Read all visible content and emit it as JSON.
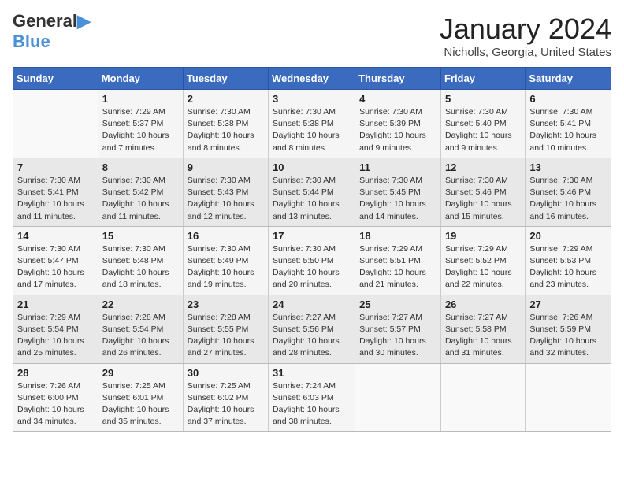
{
  "logo": {
    "text1": "General",
    "text2": "Blue"
  },
  "title": "January 2024",
  "location": "Nicholls, Georgia, United States",
  "headers": [
    "Sunday",
    "Monday",
    "Tuesday",
    "Wednesday",
    "Thursday",
    "Friday",
    "Saturday"
  ],
  "weeks": [
    [
      {
        "num": "",
        "info": ""
      },
      {
        "num": "1",
        "info": "Sunrise: 7:29 AM\nSunset: 5:37 PM\nDaylight: 10 hours\nand 7 minutes."
      },
      {
        "num": "2",
        "info": "Sunrise: 7:30 AM\nSunset: 5:38 PM\nDaylight: 10 hours\nand 8 minutes."
      },
      {
        "num": "3",
        "info": "Sunrise: 7:30 AM\nSunset: 5:38 PM\nDaylight: 10 hours\nand 8 minutes."
      },
      {
        "num": "4",
        "info": "Sunrise: 7:30 AM\nSunset: 5:39 PM\nDaylight: 10 hours\nand 9 minutes."
      },
      {
        "num": "5",
        "info": "Sunrise: 7:30 AM\nSunset: 5:40 PM\nDaylight: 10 hours\nand 9 minutes."
      },
      {
        "num": "6",
        "info": "Sunrise: 7:30 AM\nSunset: 5:41 PM\nDaylight: 10 hours\nand 10 minutes."
      }
    ],
    [
      {
        "num": "7",
        "info": "Sunrise: 7:30 AM\nSunset: 5:41 PM\nDaylight: 10 hours\nand 11 minutes."
      },
      {
        "num": "8",
        "info": "Sunrise: 7:30 AM\nSunset: 5:42 PM\nDaylight: 10 hours\nand 11 minutes."
      },
      {
        "num": "9",
        "info": "Sunrise: 7:30 AM\nSunset: 5:43 PM\nDaylight: 10 hours\nand 12 minutes."
      },
      {
        "num": "10",
        "info": "Sunrise: 7:30 AM\nSunset: 5:44 PM\nDaylight: 10 hours\nand 13 minutes."
      },
      {
        "num": "11",
        "info": "Sunrise: 7:30 AM\nSunset: 5:45 PM\nDaylight: 10 hours\nand 14 minutes."
      },
      {
        "num": "12",
        "info": "Sunrise: 7:30 AM\nSunset: 5:46 PM\nDaylight: 10 hours\nand 15 minutes."
      },
      {
        "num": "13",
        "info": "Sunrise: 7:30 AM\nSunset: 5:46 PM\nDaylight: 10 hours\nand 16 minutes."
      }
    ],
    [
      {
        "num": "14",
        "info": "Sunrise: 7:30 AM\nSunset: 5:47 PM\nDaylight: 10 hours\nand 17 minutes."
      },
      {
        "num": "15",
        "info": "Sunrise: 7:30 AM\nSunset: 5:48 PM\nDaylight: 10 hours\nand 18 minutes."
      },
      {
        "num": "16",
        "info": "Sunrise: 7:30 AM\nSunset: 5:49 PM\nDaylight: 10 hours\nand 19 minutes."
      },
      {
        "num": "17",
        "info": "Sunrise: 7:30 AM\nSunset: 5:50 PM\nDaylight: 10 hours\nand 20 minutes."
      },
      {
        "num": "18",
        "info": "Sunrise: 7:29 AM\nSunset: 5:51 PM\nDaylight: 10 hours\nand 21 minutes."
      },
      {
        "num": "19",
        "info": "Sunrise: 7:29 AM\nSunset: 5:52 PM\nDaylight: 10 hours\nand 22 minutes."
      },
      {
        "num": "20",
        "info": "Sunrise: 7:29 AM\nSunset: 5:53 PM\nDaylight: 10 hours\nand 23 minutes."
      }
    ],
    [
      {
        "num": "21",
        "info": "Sunrise: 7:29 AM\nSunset: 5:54 PM\nDaylight: 10 hours\nand 25 minutes."
      },
      {
        "num": "22",
        "info": "Sunrise: 7:28 AM\nSunset: 5:54 PM\nDaylight: 10 hours\nand 26 minutes."
      },
      {
        "num": "23",
        "info": "Sunrise: 7:28 AM\nSunset: 5:55 PM\nDaylight: 10 hours\nand 27 minutes."
      },
      {
        "num": "24",
        "info": "Sunrise: 7:27 AM\nSunset: 5:56 PM\nDaylight: 10 hours\nand 28 minutes."
      },
      {
        "num": "25",
        "info": "Sunrise: 7:27 AM\nSunset: 5:57 PM\nDaylight: 10 hours\nand 30 minutes."
      },
      {
        "num": "26",
        "info": "Sunrise: 7:27 AM\nSunset: 5:58 PM\nDaylight: 10 hours\nand 31 minutes."
      },
      {
        "num": "27",
        "info": "Sunrise: 7:26 AM\nSunset: 5:59 PM\nDaylight: 10 hours\nand 32 minutes."
      }
    ],
    [
      {
        "num": "28",
        "info": "Sunrise: 7:26 AM\nSunset: 6:00 PM\nDaylight: 10 hours\nand 34 minutes."
      },
      {
        "num": "29",
        "info": "Sunrise: 7:25 AM\nSunset: 6:01 PM\nDaylight: 10 hours\nand 35 minutes."
      },
      {
        "num": "30",
        "info": "Sunrise: 7:25 AM\nSunset: 6:02 PM\nDaylight: 10 hours\nand 37 minutes."
      },
      {
        "num": "31",
        "info": "Sunrise: 7:24 AM\nSunset: 6:03 PM\nDaylight: 10 hours\nand 38 minutes."
      },
      {
        "num": "",
        "info": ""
      },
      {
        "num": "",
        "info": ""
      },
      {
        "num": "",
        "info": ""
      }
    ]
  ]
}
